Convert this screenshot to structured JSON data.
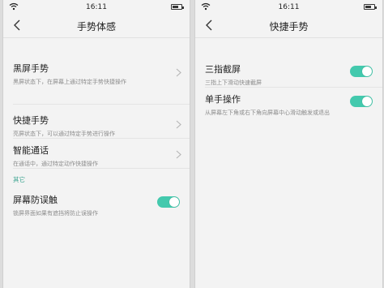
{
  "left_screen": {
    "status": {
      "time": "16:11"
    },
    "title": "手势体感",
    "items": [
      {
        "title": "黑屏手势",
        "subtitle": "黑屏状态下，在屏幕上通过特定手势快捷操作"
      },
      {
        "title": "快捷手势",
        "subtitle": "亮屏状态下，可以通过特定手势进行操作"
      },
      {
        "title": "智能通话",
        "subtitle": "在通话中，通过特定动作快捷操作"
      }
    ],
    "section_label": "其它",
    "toggle_item": {
      "title": "屏幕防误触",
      "subtitle": "锁屏界面如果有遮挡将防止误操作",
      "on": true
    }
  },
  "right_screen": {
    "status": {
      "time": "16:11"
    },
    "title": "快捷手势",
    "items": [
      {
        "title": "三指截屏",
        "subtitle": "三指上下滑动快速截屏",
        "on": true
      },
      {
        "title": "单手操作",
        "subtitle": "从屏幕左下角或右下角向屏幕中心滑动触发或退出",
        "on": true
      }
    ]
  },
  "colors": {
    "accent": "#43c9ad",
    "section_text": "#3aa38f",
    "background": "#f3f3f3"
  },
  "icons": [
    "wifi-icon",
    "battery-icon",
    "back-arrow-icon",
    "chevron-right-icon"
  ]
}
